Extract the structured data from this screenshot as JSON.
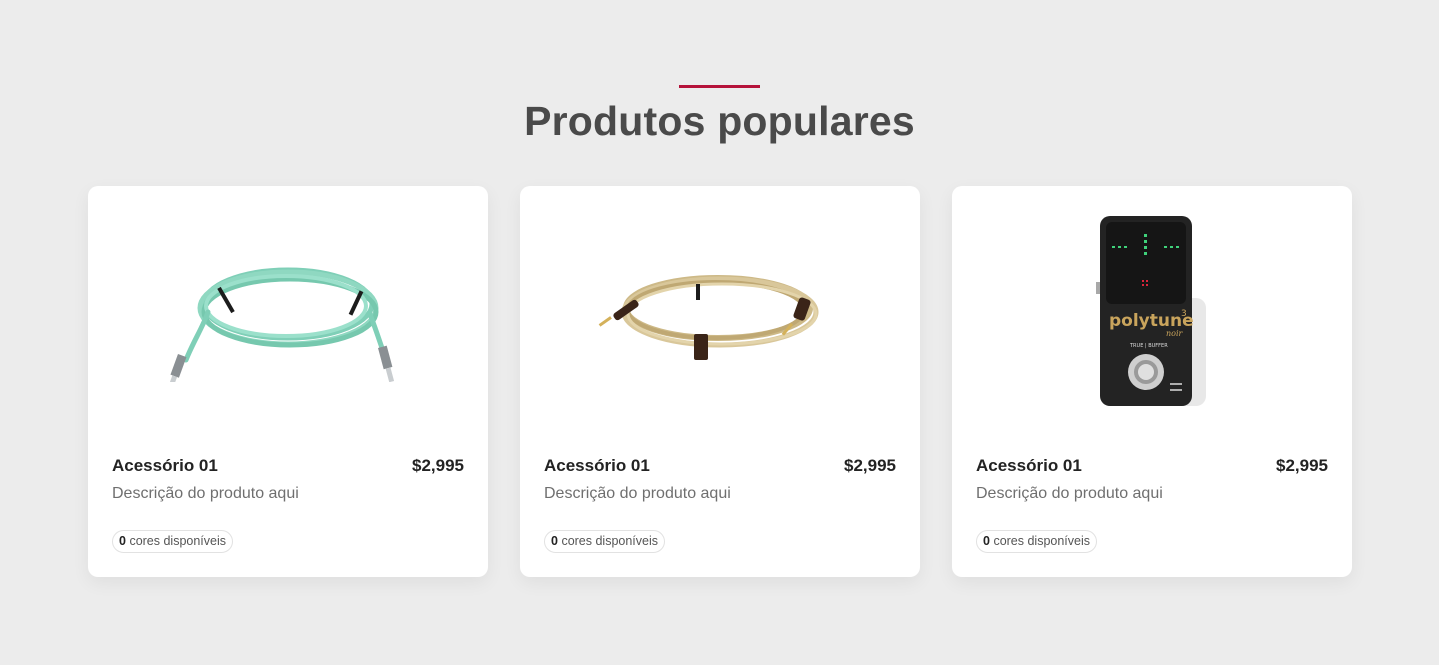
{
  "section": {
    "title": "Produtos populares",
    "accent_color": "#b5123a"
  },
  "products": [
    {
      "name": "Acessório 01",
      "price": "$2,995",
      "description": "Descrição do produto aqui",
      "colors_count": "0",
      "colors_label": "cores disponíveis",
      "image": "teal-instrument-cable"
    },
    {
      "name": "Acessório 01",
      "price": "$2,995",
      "description": "Descrição do produto aqui",
      "colors_count": "0",
      "colors_label": "cores disponíveis",
      "image": "tweed-instrument-cable"
    },
    {
      "name": "Acessório 01",
      "price": "$2,995",
      "description": "Descrição do produto aqui",
      "colors_count": "0",
      "colors_label": "cores disponíveis",
      "image": "tuner-pedal",
      "image_text": {
        "brand": "polytune",
        "superscript": "3",
        "sub": "noir",
        "switch_label": "TRUE | BUFFER"
      }
    }
  ]
}
